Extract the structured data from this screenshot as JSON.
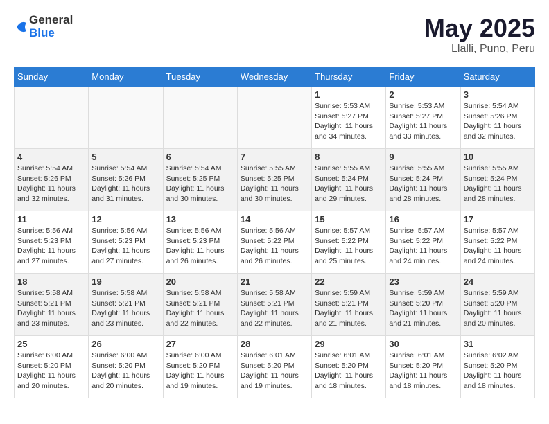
{
  "header": {
    "logo_general": "General",
    "logo_blue": "Blue",
    "title": "May 2025",
    "subtitle": "Llalli, Puno, Peru"
  },
  "days_of_week": [
    "Sunday",
    "Monday",
    "Tuesday",
    "Wednesday",
    "Thursday",
    "Friday",
    "Saturday"
  ],
  "weeks": [
    [
      {
        "day": "",
        "empty": true
      },
      {
        "day": "",
        "empty": true
      },
      {
        "day": "",
        "empty": true
      },
      {
        "day": "",
        "empty": true
      },
      {
        "day": "1",
        "lines": [
          "Sunrise: 5:53 AM",
          "Sunset: 5:27 PM",
          "Daylight: 11 hours",
          "and 34 minutes."
        ]
      },
      {
        "day": "2",
        "lines": [
          "Sunrise: 5:53 AM",
          "Sunset: 5:27 PM",
          "Daylight: 11 hours",
          "and 33 minutes."
        ]
      },
      {
        "day": "3",
        "lines": [
          "Sunrise: 5:54 AM",
          "Sunset: 5:26 PM",
          "Daylight: 11 hours",
          "and 32 minutes."
        ]
      }
    ],
    [
      {
        "day": "4",
        "lines": [
          "Sunrise: 5:54 AM",
          "Sunset: 5:26 PM",
          "Daylight: 11 hours",
          "and 32 minutes."
        ]
      },
      {
        "day": "5",
        "lines": [
          "Sunrise: 5:54 AM",
          "Sunset: 5:26 PM",
          "Daylight: 11 hours",
          "and 31 minutes."
        ]
      },
      {
        "day": "6",
        "lines": [
          "Sunrise: 5:54 AM",
          "Sunset: 5:25 PM",
          "Daylight: 11 hours",
          "and 30 minutes."
        ]
      },
      {
        "day": "7",
        "lines": [
          "Sunrise: 5:55 AM",
          "Sunset: 5:25 PM",
          "Daylight: 11 hours",
          "and 30 minutes."
        ]
      },
      {
        "day": "8",
        "lines": [
          "Sunrise: 5:55 AM",
          "Sunset: 5:24 PM",
          "Daylight: 11 hours",
          "and 29 minutes."
        ]
      },
      {
        "day": "9",
        "lines": [
          "Sunrise: 5:55 AM",
          "Sunset: 5:24 PM",
          "Daylight: 11 hours",
          "and 28 minutes."
        ]
      },
      {
        "day": "10",
        "lines": [
          "Sunrise: 5:55 AM",
          "Sunset: 5:24 PM",
          "Daylight: 11 hours",
          "and 28 minutes."
        ]
      }
    ],
    [
      {
        "day": "11",
        "lines": [
          "Sunrise: 5:56 AM",
          "Sunset: 5:23 PM",
          "Daylight: 11 hours",
          "and 27 minutes."
        ]
      },
      {
        "day": "12",
        "lines": [
          "Sunrise: 5:56 AM",
          "Sunset: 5:23 PM",
          "Daylight: 11 hours",
          "and 27 minutes."
        ]
      },
      {
        "day": "13",
        "lines": [
          "Sunrise: 5:56 AM",
          "Sunset: 5:23 PM",
          "Daylight: 11 hours",
          "and 26 minutes."
        ]
      },
      {
        "day": "14",
        "lines": [
          "Sunrise: 5:56 AM",
          "Sunset: 5:22 PM",
          "Daylight: 11 hours",
          "and 26 minutes."
        ]
      },
      {
        "day": "15",
        "lines": [
          "Sunrise: 5:57 AM",
          "Sunset: 5:22 PM",
          "Daylight: 11 hours",
          "and 25 minutes."
        ]
      },
      {
        "day": "16",
        "lines": [
          "Sunrise: 5:57 AM",
          "Sunset: 5:22 PM",
          "Daylight: 11 hours",
          "and 24 minutes."
        ]
      },
      {
        "day": "17",
        "lines": [
          "Sunrise: 5:57 AM",
          "Sunset: 5:22 PM",
          "Daylight: 11 hours",
          "and 24 minutes."
        ]
      }
    ],
    [
      {
        "day": "18",
        "lines": [
          "Sunrise: 5:58 AM",
          "Sunset: 5:21 PM",
          "Daylight: 11 hours",
          "and 23 minutes."
        ]
      },
      {
        "day": "19",
        "lines": [
          "Sunrise: 5:58 AM",
          "Sunset: 5:21 PM",
          "Daylight: 11 hours",
          "and 23 minutes."
        ]
      },
      {
        "day": "20",
        "lines": [
          "Sunrise: 5:58 AM",
          "Sunset: 5:21 PM",
          "Daylight: 11 hours",
          "and 22 minutes."
        ]
      },
      {
        "day": "21",
        "lines": [
          "Sunrise: 5:58 AM",
          "Sunset: 5:21 PM",
          "Daylight: 11 hours",
          "and 22 minutes."
        ]
      },
      {
        "day": "22",
        "lines": [
          "Sunrise: 5:59 AM",
          "Sunset: 5:21 PM",
          "Daylight: 11 hours",
          "and 21 minutes."
        ]
      },
      {
        "day": "23",
        "lines": [
          "Sunrise: 5:59 AM",
          "Sunset: 5:20 PM",
          "Daylight: 11 hours",
          "and 21 minutes."
        ]
      },
      {
        "day": "24",
        "lines": [
          "Sunrise: 5:59 AM",
          "Sunset: 5:20 PM",
          "Daylight: 11 hours",
          "and 20 minutes."
        ]
      }
    ],
    [
      {
        "day": "25",
        "lines": [
          "Sunrise: 6:00 AM",
          "Sunset: 5:20 PM",
          "Daylight: 11 hours",
          "and 20 minutes."
        ]
      },
      {
        "day": "26",
        "lines": [
          "Sunrise: 6:00 AM",
          "Sunset: 5:20 PM",
          "Daylight: 11 hours",
          "and 20 minutes."
        ]
      },
      {
        "day": "27",
        "lines": [
          "Sunrise: 6:00 AM",
          "Sunset: 5:20 PM",
          "Daylight: 11 hours",
          "and 19 minutes."
        ]
      },
      {
        "day": "28",
        "lines": [
          "Sunrise: 6:01 AM",
          "Sunset: 5:20 PM",
          "Daylight: 11 hours",
          "and 19 minutes."
        ]
      },
      {
        "day": "29",
        "lines": [
          "Sunrise: 6:01 AM",
          "Sunset: 5:20 PM",
          "Daylight: 11 hours",
          "and 18 minutes."
        ]
      },
      {
        "day": "30",
        "lines": [
          "Sunrise: 6:01 AM",
          "Sunset: 5:20 PM",
          "Daylight: 11 hours",
          "and 18 minutes."
        ]
      },
      {
        "day": "31",
        "lines": [
          "Sunrise: 6:02 AM",
          "Sunset: 5:20 PM",
          "Daylight: 11 hours",
          "and 18 minutes."
        ]
      }
    ]
  ]
}
